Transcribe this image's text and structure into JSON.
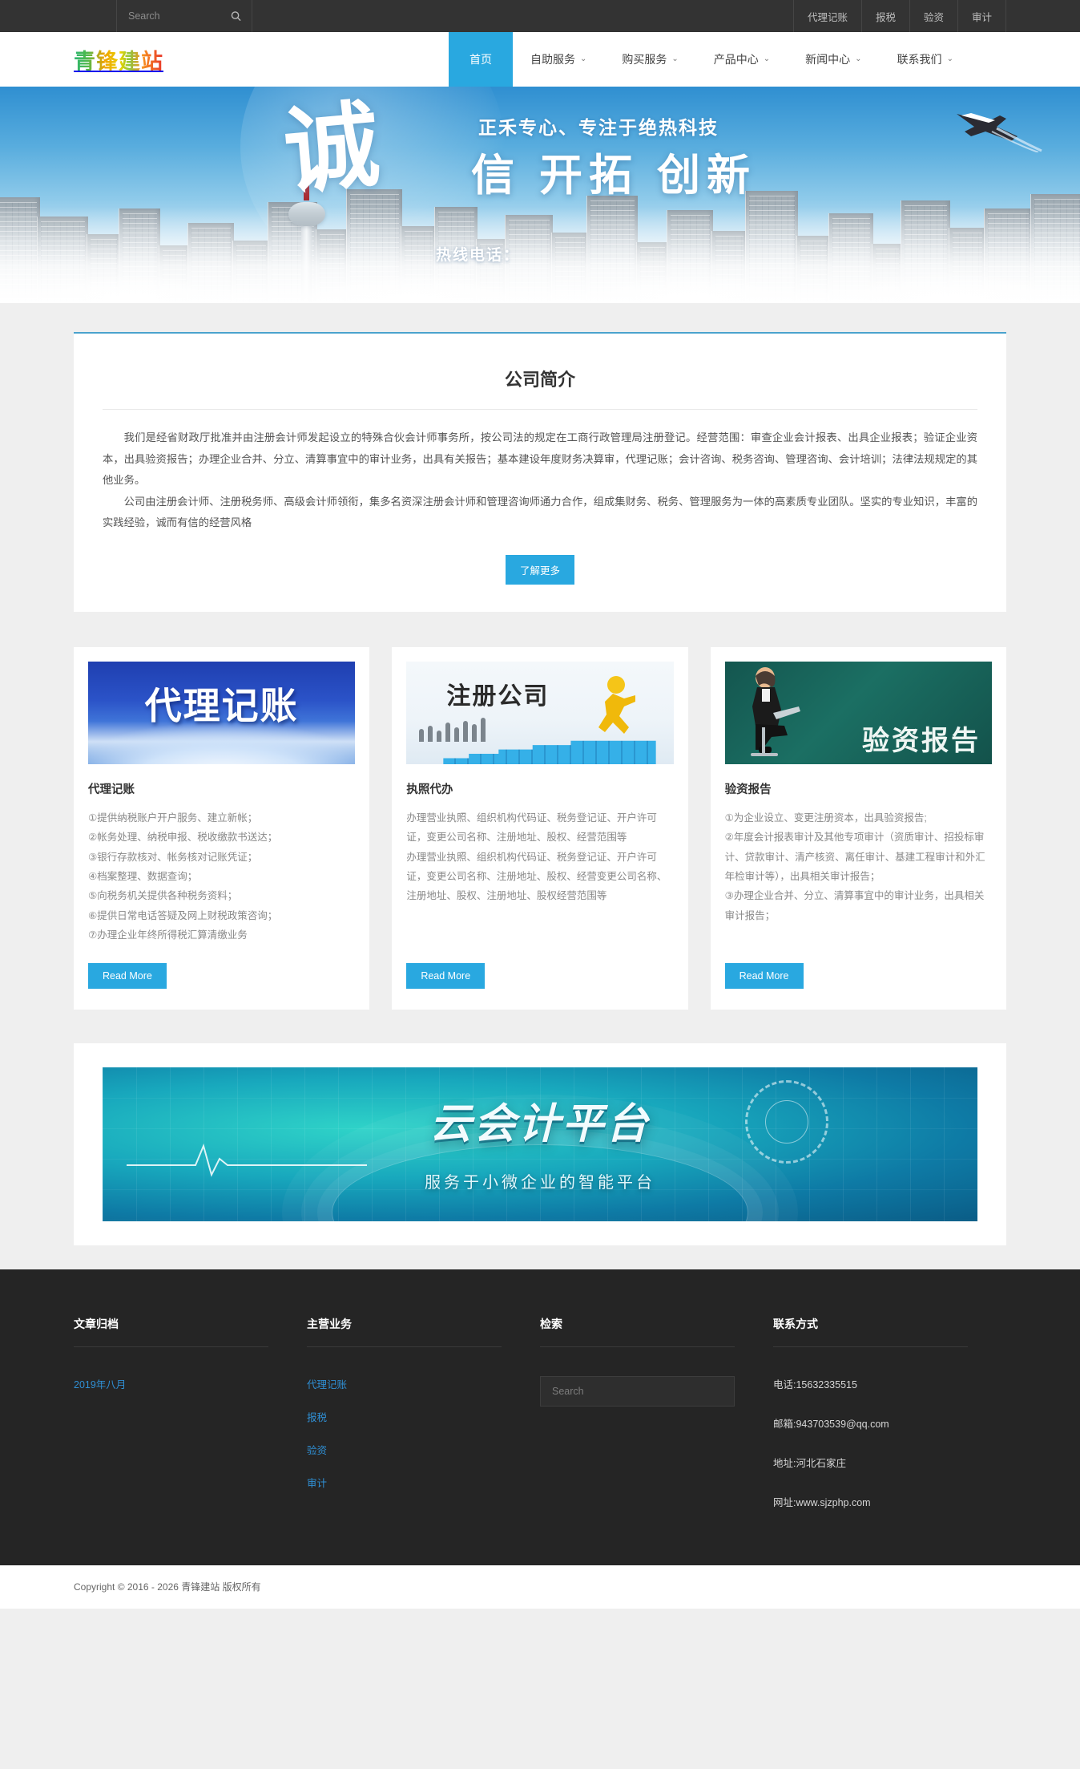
{
  "topbar": {
    "search": {
      "placeholder": "Search",
      "value": "",
      "icon": "search-icon"
    },
    "links": [
      "代理记账",
      "报税",
      "验资",
      "审计"
    ]
  },
  "header": {
    "logo": "青锋建站",
    "nav": [
      {
        "label": "首页",
        "active": true,
        "caret": ""
      },
      {
        "label": "自助服务",
        "active": false,
        "caret": "⌄"
      },
      {
        "label": "购买服务",
        "active": false,
        "caret": "⌄"
      },
      {
        "label": "产品中心",
        "active": false,
        "caret": "⌄"
      },
      {
        "label": "新闻中心",
        "active": false,
        "caret": "⌄"
      },
      {
        "label": "联系我们",
        "active": false,
        "caret": "⌄"
      }
    ]
  },
  "hero": {
    "big_char": "诚",
    "subtitle": "正禾专心、专注于绝热科技",
    "headline": "信 开拓 创新",
    "hotline": "热线电话："
  },
  "about": {
    "title": "公司简介",
    "paragraph1": "我们是经省财政厅批准并由注册会计师发起设立的特殊合伙会计师事务所，按公司法的规定在工商行政管理局注册登记。经营范围：审查企业会计报表、出具企业报表；验证企业资本，出具验资报告；办理企业合并、分立、清算事宜中的审计业务，出具有关报告；基本建设年度财务决算审，代理记账；会计咨询、税务咨询、管理咨询、会计培训；法律法规规定的其他业务。",
    "paragraph2": "公司由注册会计师、注册税务师、高级会计师领衔，集多名资深注册会计师和管理咨询师通力合作，组成集财务、税务、管理服务为一体的高素质专业团队。坚实的专业知识，丰富的实践经验，诚而有信的经营风格",
    "more_label": "了解更多"
  },
  "cards": [
    {
      "thumb_text": "代理记账",
      "title": "代理记账",
      "body": "①提供纳税账户开户服务、建立新帐；\n②帐务处理、纳税申报、税收缴款书送达；\n③银行存款核对、帐务核对记账凭证；\n④档案整理、数据查询；\n⑤向税务机关提供各种税务资料；\n⑥提供日常电话答疑及网上财税政策咨询；\n⑦办理企业年终所得税汇算清缴业务",
      "button": "Read More"
    },
    {
      "thumb_text": "注册公司",
      "title": "执照代办",
      "body": "办理营业执照、组织机构代码证、税务登记证、开户许可证，变更公司名称、注册地址、股权、经营范围等\n办理营业执照、组织机构代码证、税务登记证、开户许可证，变更公司名称、注册地址、股权、经营变更公司名称、注册地址、股权、注册地址、股权经营范围等",
      "button": "Read More"
    },
    {
      "thumb_text": "验资报告",
      "title": "验资报告",
      "body": "①为企业设立、变更注册资本，出具验资报告;\n②年度会计报表审计及其他专项审计（资质审计、招投标审计、贷款审计、清产核资、离任审计、基建工程审计和外汇年检审计等），出具相关审计报告；\n③办理企业合并、分立、清算事宜中的审计业务，出具相关审计报告；",
      "button": "Read More"
    }
  ],
  "wide_banner": {
    "title": "云会计平台",
    "subtitle": "服务于小微企业的智能平台"
  },
  "footer": {
    "archive": {
      "heading": "文章归档",
      "items": [
        "2019年八月"
      ]
    },
    "business": {
      "heading": "主营业务",
      "items": [
        "代理记账",
        "报税",
        "验资",
        "审计"
      ]
    },
    "search": {
      "heading": "检索",
      "placeholder": "Search",
      "value": ""
    },
    "contact": {
      "heading": "联系方式",
      "lines": [
        "电话:15632335515",
        "邮箱:943703539@qq.com",
        "地址:河北石家庄",
        "网址:www.sjzphp.com"
      ]
    }
  },
  "copyright": "Copyright © 2016 - 2026 青锋建站 版权所有",
  "colors": {
    "accent": "#29a8e0",
    "topbar_bg": "#333333",
    "footer_bg": "#252525",
    "link_blue": "#2f8fd4"
  }
}
